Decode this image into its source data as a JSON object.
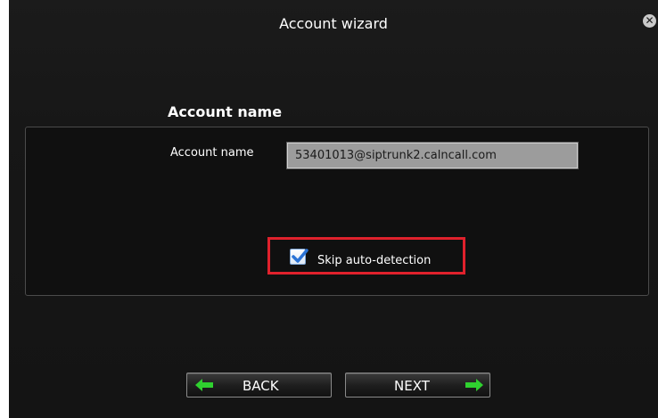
{
  "window": {
    "title": "Account wizard",
    "close_icon": "close-icon"
  },
  "section": {
    "heading": "Account name"
  },
  "form": {
    "account_name_label": "Account name",
    "account_name_value": "53401013@siptrunk2.calncall.com",
    "skip_checkbox_label": "Skip auto-detection",
    "skip_checked": true
  },
  "annotation": {
    "highlight_color": "#e0212c"
  },
  "buttons": {
    "back_label": "BACK",
    "next_label": "NEXT",
    "arrow_color": "#2fd12f"
  }
}
